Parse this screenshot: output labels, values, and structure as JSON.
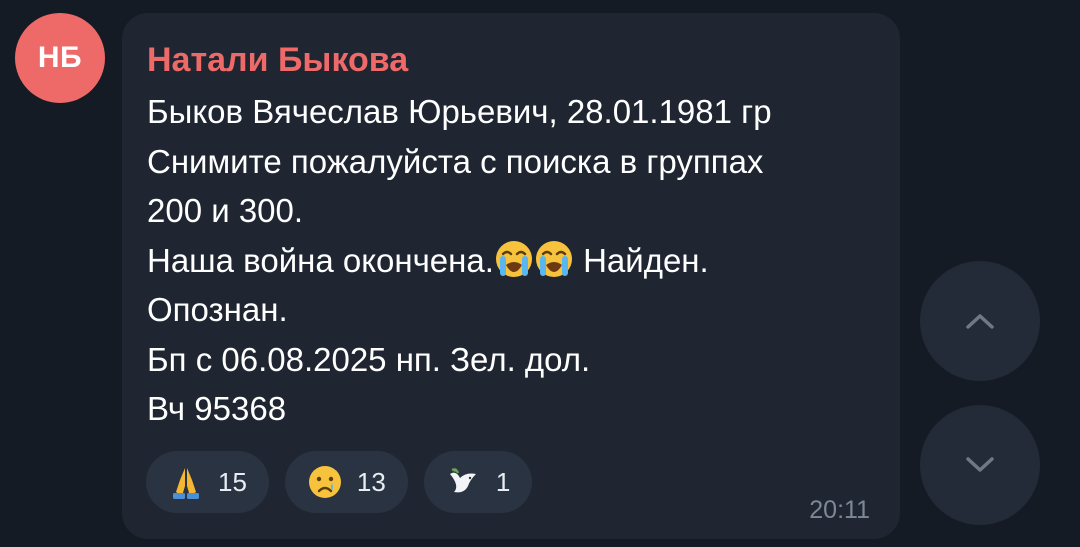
{
  "avatar": {
    "initials": "НБ",
    "color": "#ee6a68"
  },
  "message": {
    "sender": "Натали Быкова",
    "lines": [
      "Быков Вячеслав Юрьевич, 28.01.1981 гр",
      "Снимите пожалуйста с поиска в группах",
      "200 и 300.",
      "Наша война окончена.",
      "Найден.",
      "Опознан.",
      "Бп с 06.08.2025 нп. Зел. дол.",
      "Вч 95368"
    ],
    "inline_emoji": [
      "loudly-crying-face-emoji",
      "loudly-crying-face-emoji"
    ],
    "time": "20:11"
  },
  "reactions": [
    {
      "icon": "folded-hands-emoji",
      "count": "15"
    },
    {
      "icon": "crying-face-emoji",
      "count": "13"
    },
    {
      "icon": "dove-emoji",
      "count": "1"
    }
  ],
  "nav": {
    "up_icon": "chevron-up-icon",
    "down_icon": "chevron-down-icon"
  },
  "colors": {
    "background": "#151b24",
    "bubble": "#1f2632",
    "sender": "#ee6a68",
    "text": "#ffffff",
    "time": "#7d8896",
    "reaction_bg": "#2a3341",
    "nav_bg": "#232b38"
  }
}
